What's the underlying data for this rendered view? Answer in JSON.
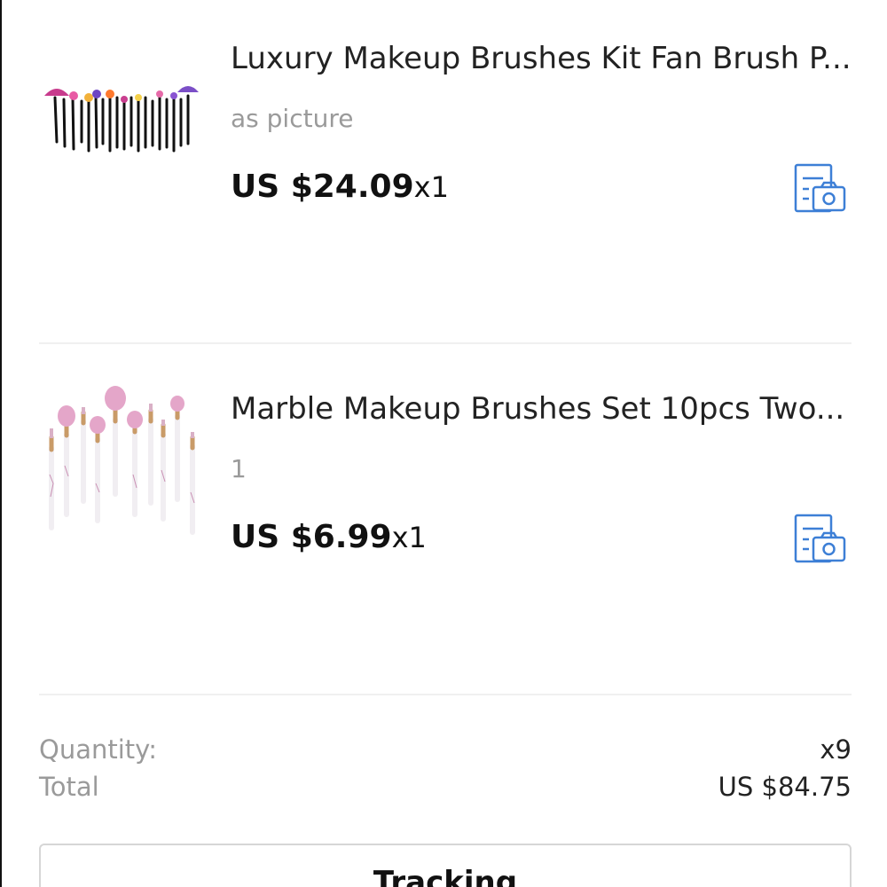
{
  "orders": [
    {
      "title": "Luxury Makeup Brushes Kit Fan Brush P...",
      "variant": "as picture",
      "price": "US $24.09",
      "quantity": "x1",
      "review_icon": "add-photo-review-icon",
      "thumbnail": "black-fan-brush-set-image"
    },
    {
      "title": "Marble Makeup Brushes Set 10pcs Two...",
      "variant": "1",
      "price": "US $6.99",
      "quantity": "x1",
      "review_icon": "add-photo-review-icon",
      "thumbnail": "marble-brush-set-image"
    }
  ],
  "summary": {
    "quantity_label": "Quantity:",
    "quantity_value": "x9",
    "total_label": "Total",
    "total_value": "US $84.75"
  },
  "actions": {
    "tracking_label": "Tracking"
  },
  "colors": {
    "icon_blue": "#3d7fd6",
    "muted_text": "#9a9a9a",
    "divider": "#f0f0f0"
  }
}
